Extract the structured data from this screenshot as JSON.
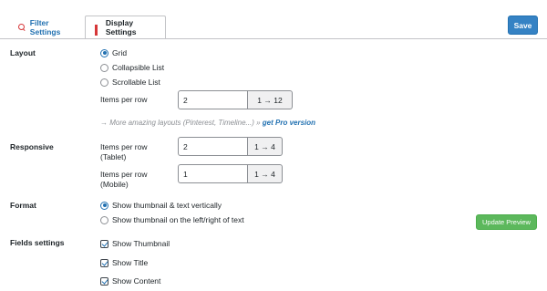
{
  "tabs": {
    "filter_label": "Filter Settings",
    "display_label": "Display Settings",
    "filter_icon": "search-icon",
    "display_icon": "grid-icon"
  },
  "save_label": "Save",
  "layout": {
    "label": "Layout",
    "options": [
      "Grid",
      "Collapsible List",
      "Scrollable List"
    ],
    "selected": "Grid",
    "items_per_row_label": "Items per row",
    "items_per_row_value": "2",
    "items_per_row_range": "1 → 12",
    "pro_note_text": "→ More amazing layouts (Pinterest, Timeline...) »",
    "pro_link_text": "get Pro version"
  },
  "responsive": {
    "label": "Responsive",
    "tablet_label_line1": "Items per row",
    "tablet_label_line2": "(Tablet)",
    "tablet_value": "2",
    "tablet_range": "1 → 4",
    "mobile_label_line1": "Items per row",
    "mobile_label_line2": "(Mobile)",
    "mobile_value": "1",
    "mobile_range": "1 → 4"
  },
  "format": {
    "label": "Format",
    "options": [
      "Show thumbnail & text vertically",
      "Show thumbnail on the left/right of text"
    ],
    "selected": "Show thumbnail & text vertically",
    "update_preview_label": "Update Preview"
  },
  "fields": {
    "label": "Fields settings",
    "items": [
      {
        "label": "Show Thumbnail",
        "checked": true
      },
      {
        "label": "Show Title",
        "checked": true
      },
      {
        "label": "Show Content",
        "checked": true
      }
    ]
  },
  "colors": {
    "accent": "#2271b1",
    "save_button": "#3582c4",
    "preview_button": "#5cb85c",
    "tab_icon": "#d63638"
  }
}
